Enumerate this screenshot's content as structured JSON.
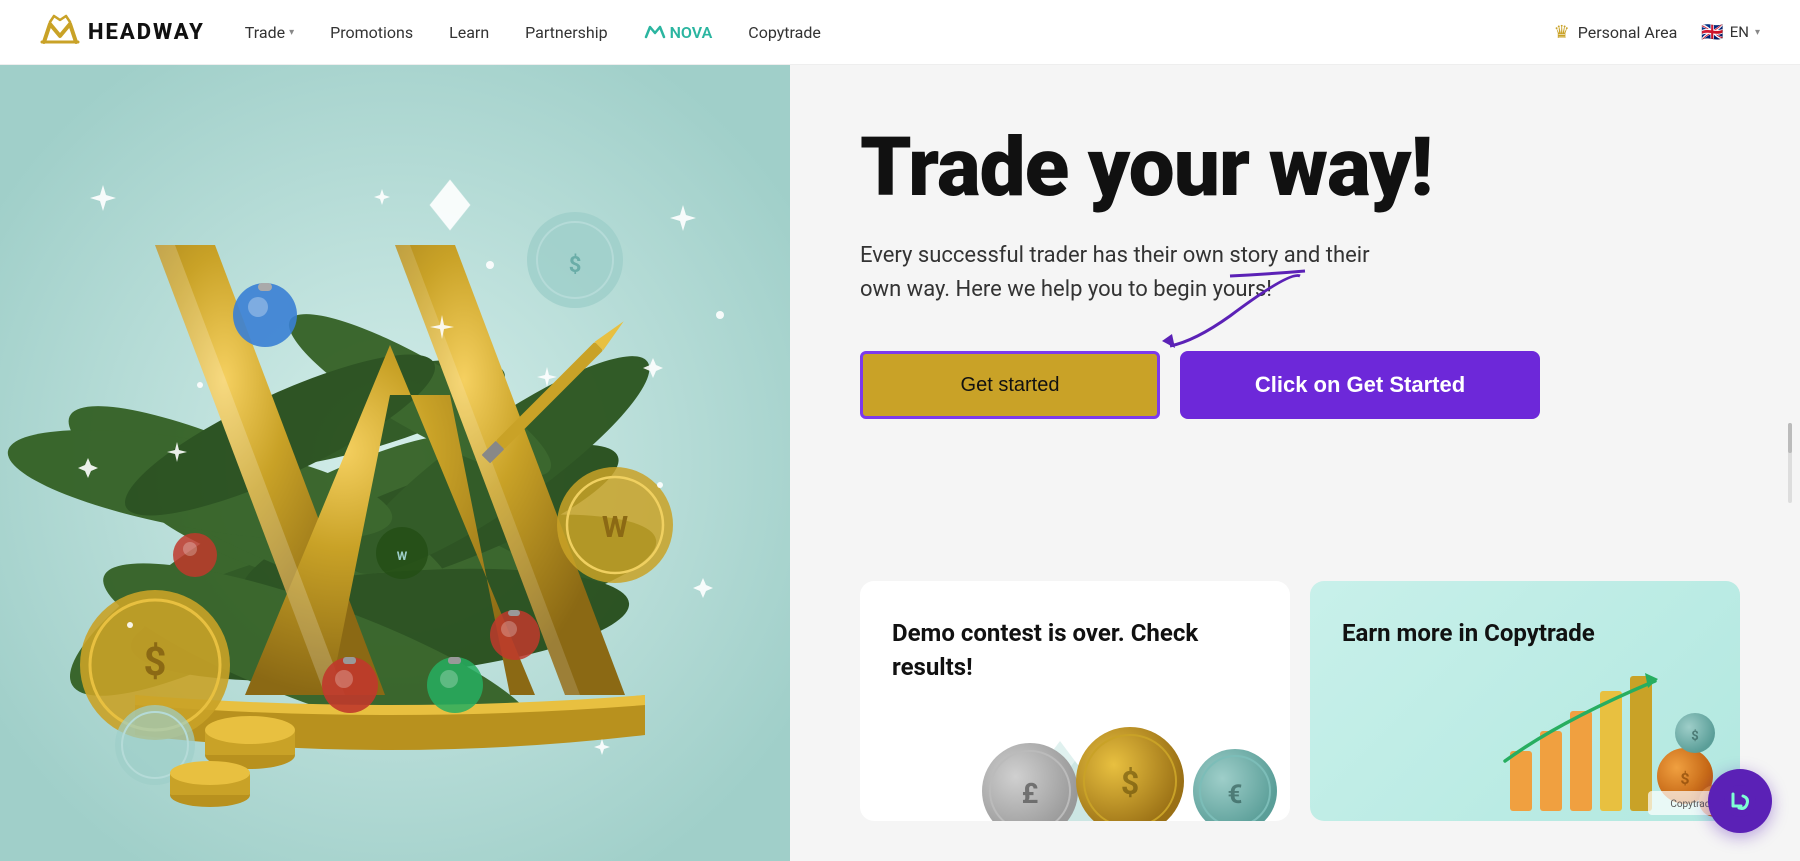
{
  "navbar": {
    "logo_text": "HEADWAY",
    "nav_items": [
      {
        "label": "Trade",
        "has_chevron": true,
        "id": "trade"
      },
      {
        "label": "Promotions",
        "has_chevron": false,
        "id": "promotions"
      },
      {
        "label": "Learn",
        "has_chevron": false,
        "id": "learn"
      },
      {
        "label": "Partnership",
        "has_chevron": false,
        "id": "partnership"
      },
      {
        "label": "NOVA",
        "has_chevron": false,
        "id": "nova",
        "special": "nova"
      },
      {
        "label": "Copytrade",
        "has_chevron": false,
        "id": "copytrade"
      }
    ],
    "personal_area_label": "Personal Area",
    "lang_label": "EN"
  },
  "hero": {
    "title": "Trade your way!",
    "subtitle": "Every successful trader has their own story and their own way. Here we help you to begin yours!",
    "btn_get_started": "Get started",
    "btn_click_started": "Click on Get Started"
  },
  "cards": [
    {
      "id": "demo-contest",
      "title": "Demo contest is over. Check results!"
    },
    {
      "id": "copytrade",
      "title": "Earn more in Copytrade"
    }
  ],
  "colors": {
    "gold": "#c9a227",
    "purple": "#6d28d9",
    "purple_border": "#7c3aed",
    "nova_green": "#2bb5a0",
    "teal_bg": "#c8f0ea"
  }
}
